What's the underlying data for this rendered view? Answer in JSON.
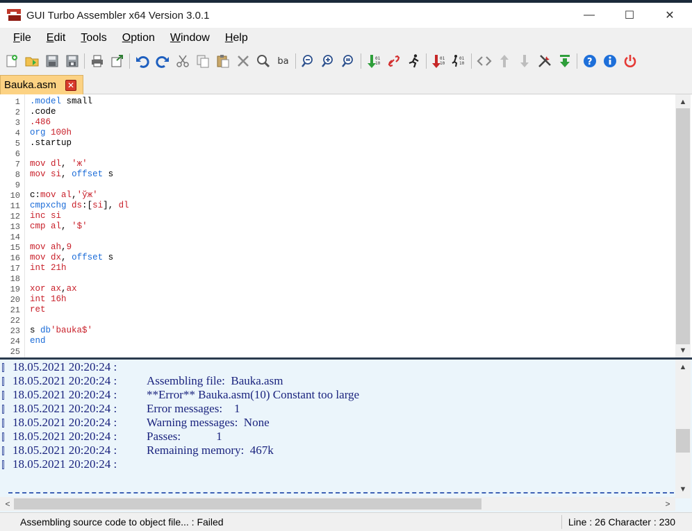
{
  "window": {
    "title": "GUI Turbo Assembler x64 Version 3.0.1",
    "minimize_glyph": "—",
    "maximize_glyph": "☐",
    "close_glyph": "✕"
  },
  "menu": {
    "file": {
      "accel": "F",
      "rest": "ile"
    },
    "edit": {
      "accel": "E",
      "rest": "dit"
    },
    "tools": {
      "accel": "T",
      "rest": "ools"
    },
    "option": {
      "accel": "O",
      "rest": "ption"
    },
    "window": {
      "accel": "W",
      "rest": "indow"
    },
    "help": {
      "accel": "H",
      "rest": "elp"
    }
  },
  "toolbar": {
    "icons": [
      "new-file-icon",
      "open-folder-icon",
      "save-icon",
      "save-all-icon",
      "print-icon",
      "export-icon",
      "undo-icon",
      "redo-icon",
      "cut-icon",
      "copy-icon",
      "paste-icon",
      "delete-icon",
      "find-icon",
      "replace-icon",
      "zoom-out-icon",
      "zoom-in-icon",
      "zoom-reset-icon",
      "assemble-icon",
      "link-icon",
      "run-icon",
      "assemble-run-icon",
      "debug-icon",
      "code-icon",
      "move-up-icon",
      "move-down-icon",
      "tools-icon",
      "download-icon",
      "help-icon",
      "info-icon",
      "power-icon"
    ],
    "replace_label": "ba"
  },
  "tab": {
    "filename": "Bauka.asm",
    "close_glyph": "✕",
    "active_color": "#fcd283"
  },
  "editor": {
    "lines": [
      {
        "n": "1",
        "tokens": [
          {
            "t": ".model",
            "c": "kw"
          },
          {
            "t": " small",
            "c": "plain"
          }
        ]
      },
      {
        "n": "2",
        "tokens": [
          {
            "t": ".code",
            "c": "plain"
          }
        ]
      },
      {
        "n": "3",
        "tokens": [
          {
            "t": ".486",
            "c": "num"
          }
        ]
      },
      {
        "n": "4",
        "tokens": [
          {
            "t": "org",
            "c": "kw"
          },
          {
            "t": " ",
            "c": "plain"
          },
          {
            "t": "100h",
            "c": "num"
          }
        ]
      },
      {
        "n": "5",
        "tokens": [
          {
            "t": ".startup",
            "c": "plain"
          }
        ]
      },
      {
        "n": "6",
        "tokens": []
      },
      {
        "n": "7",
        "tokens": [
          {
            "t": "mov",
            "c": "num"
          },
          {
            "t": " ",
            "c": "plain"
          },
          {
            "t": "dl",
            "c": "num"
          },
          {
            "t": ", ",
            "c": "plain"
          },
          {
            "t": "'ж'",
            "c": "str"
          }
        ]
      },
      {
        "n": "8",
        "tokens": [
          {
            "t": "mov",
            "c": "num"
          },
          {
            "t": " ",
            "c": "plain"
          },
          {
            "t": "si",
            "c": "num"
          },
          {
            "t": ", ",
            "c": "plain"
          },
          {
            "t": "offset",
            "c": "kw"
          },
          {
            "t": " s",
            "c": "plain"
          }
        ]
      },
      {
        "n": "9",
        "tokens": []
      },
      {
        "n": "10",
        "tokens": [
          {
            "t": "c:",
            "c": "plain"
          },
          {
            "t": "mov",
            "c": "num"
          },
          {
            "t": " ",
            "c": "plain"
          },
          {
            "t": "al",
            "c": "num"
          },
          {
            "t": ",",
            "c": "plain"
          },
          {
            "t": "'ўж'",
            "c": "str"
          }
        ]
      },
      {
        "n": "11",
        "tokens": [
          {
            "t": "cmpxchg",
            "c": "kw"
          },
          {
            "t": " ",
            "c": "plain"
          },
          {
            "t": "ds",
            "c": "num"
          },
          {
            "t": ":[",
            "c": "plain"
          },
          {
            "t": "si",
            "c": "num"
          },
          {
            "t": "], ",
            "c": "plain"
          },
          {
            "t": "dl",
            "c": "num"
          }
        ]
      },
      {
        "n": "12",
        "tokens": [
          {
            "t": "inc",
            "c": "num"
          },
          {
            "t": " ",
            "c": "plain"
          },
          {
            "t": "si",
            "c": "num"
          }
        ]
      },
      {
        "n": "13",
        "tokens": [
          {
            "t": "cmp",
            "c": "num"
          },
          {
            "t": " ",
            "c": "plain"
          },
          {
            "t": "al",
            "c": "num"
          },
          {
            "t": ", ",
            "c": "plain"
          },
          {
            "t": "'$'",
            "c": "str"
          }
        ]
      },
      {
        "n": "14",
        "tokens": []
      },
      {
        "n": "15",
        "tokens": [
          {
            "t": "mov",
            "c": "num"
          },
          {
            "t": " ",
            "c": "plain"
          },
          {
            "t": "ah",
            "c": "num"
          },
          {
            "t": ",",
            "c": "plain"
          },
          {
            "t": "9",
            "c": "num"
          }
        ]
      },
      {
        "n": "16",
        "tokens": [
          {
            "t": "mov",
            "c": "num"
          },
          {
            "t": " ",
            "c": "plain"
          },
          {
            "t": "dx",
            "c": "num"
          },
          {
            "t": ", ",
            "c": "plain"
          },
          {
            "t": "offset",
            "c": "kw"
          },
          {
            "t": " s",
            "c": "plain"
          }
        ]
      },
      {
        "n": "17",
        "tokens": [
          {
            "t": "int",
            "c": "num"
          },
          {
            "t": " ",
            "c": "plain"
          },
          {
            "t": "21h",
            "c": "num"
          }
        ]
      },
      {
        "n": "18",
        "tokens": []
      },
      {
        "n": "19",
        "tokens": [
          {
            "t": "xor",
            "c": "num"
          },
          {
            "t": " ",
            "c": "plain"
          },
          {
            "t": "ax",
            "c": "num"
          },
          {
            "t": ",",
            "c": "plain"
          },
          {
            "t": "ax",
            "c": "num"
          }
        ]
      },
      {
        "n": "20",
        "tokens": [
          {
            "t": "int",
            "c": "num"
          },
          {
            "t": " ",
            "c": "plain"
          },
          {
            "t": "16h",
            "c": "num"
          }
        ]
      },
      {
        "n": "21",
        "tokens": [
          {
            "t": "ret",
            "c": "num"
          }
        ]
      },
      {
        "n": "22",
        "tokens": []
      },
      {
        "n": "23",
        "tokens": [
          {
            "t": "s",
            "c": "plain"
          },
          {
            "t": " db",
            "c": "kw"
          },
          {
            "t": "'bauka$'",
            "c": "str"
          }
        ]
      },
      {
        "n": "24",
        "tokens": [
          {
            "t": "end",
            "c": "kw"
          }
        ]
      },
      {
        "n": "25",
        "tokens": []
      }
    ],
    "scroll_up_glyph": "▲",
    "scroll_down_glyph": "▼"
  },
  "output": {
    "lines": [
      {
        "ts": "18.05.2021 20:20:24 :",
        "msg": ""
      },
      {
        "ts": "18.05.2021 20:20:24 :",
        "msg": "Assembling file:  Bauka.asm"
      },
      {
        "ts": "18.05.2021 20:20:24 :",
        "msg": "**Error** Bauka.asm(10) Constant too large"
      },
      {
        "ts": "18.05.2021 20:20:24 :",
        "msg": "Error messages:    1"
      },
      {
        "ts": "18.05.2021 20:20:24 :",
        "msg": "Warning messages:  None"
      },
      {
        "ts": "18.05.2021 20:20:24 :",
        "msg": "Passes:            1"
      },
      {
        "ts": "18.05.2021 20:20:24 :",
        "msg": "Remaining memory:  467k"
      },
      {
        "ts": "18.05.2021 20:20:24 :",
        "msg": ""
      }
    ],
    "scroll_up_glyph": "▲",
    "scroll_down_glyph": "▼",
    "scroll_left_glyph": "<",
    "scroll_right_glyph": ">",
    "background": "#ebf5fb",
    "text_color": "#1a237e"
  },
  "status": {
    "message": "Assembling source code to object file... : Failed",
    "position": "Line : 26 Character : 230"
  },
  "colors": {
    "keyword": "#1a6bd8",
    "literal": "#c81e28"
  }
}
